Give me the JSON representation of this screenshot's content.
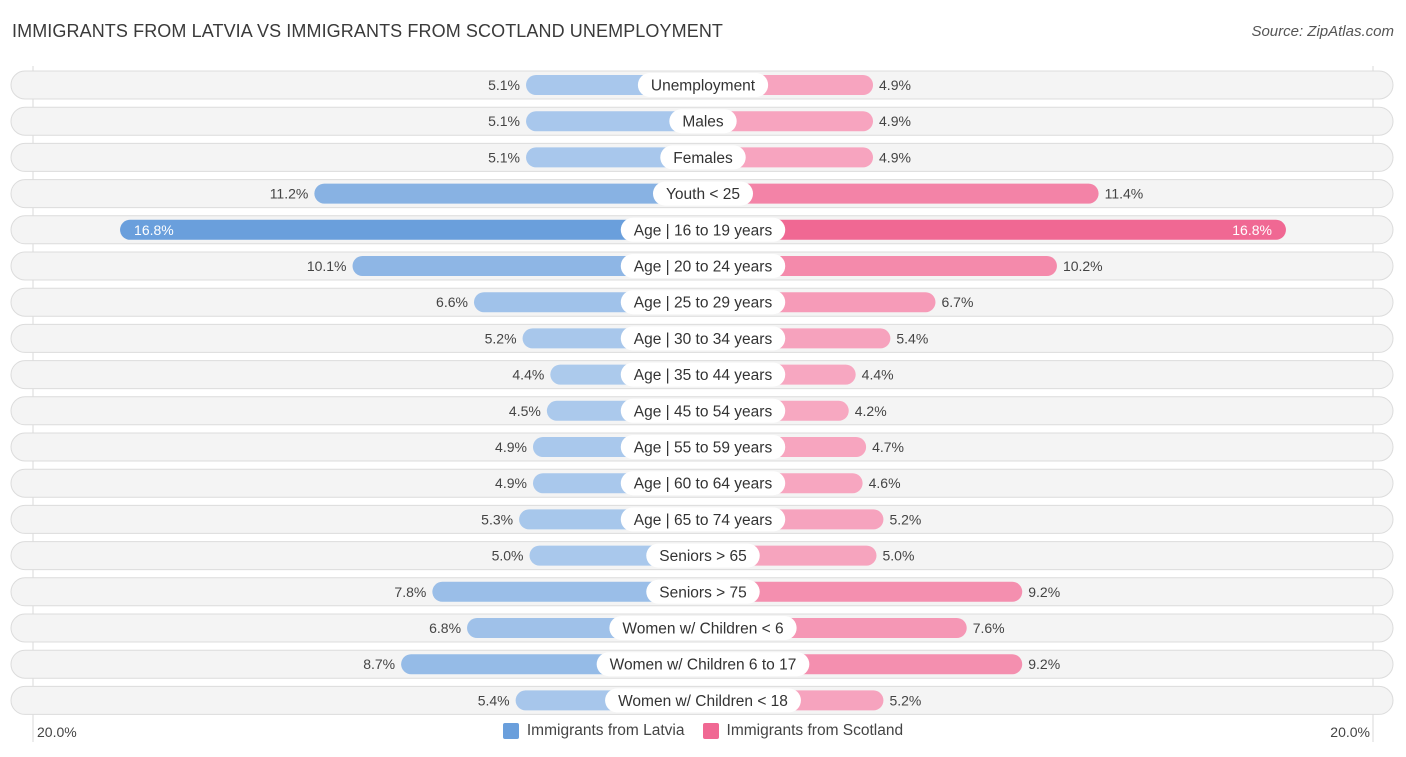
{
  "header": {
    "title": "IMMIGRANTS FROM LATVIA VS IMMIGRANTS FROM SCOTLAND UNEMPLOYMENT",
    "source": "Source: ZipAtlas.com"
  },
  "colors": {
    "latvia": "#6a9fdc",
    "latvia_light": "#aecbed",
    "scotland": "#f06893",
    "scotland_light": "#f7a9c2"
  },
  "chart_data": {
    "type": "bar",
    "orientation": "horizontal-diverging",
    "title": "IMMIGRANTS FROM LATVIA VS IMMIGRANTS FROM SCOTLAND UNEMPLOYMENT",
    "unit": "%",
    "xlim": [
      -20,
      20
    ],
    "axis_labels": {
      "left": "20.0%",
      "right": "20.0%"
    },
    "legend": {
      "placement": "bottom-center",
      "entries": [
        "Immigrants from Latvia",
        "Immigrants from Scotland"
      ]
    },
    "categories": [
      "Unemployment",
      "Males",
      "Females",
      "Youth < 25",
      "Age | 16 to 19 years",
      "Age | 20 to 24 years",
      "Age | 25 to 29 years",
      "Age | 30 to 34 years",
      "Age | 35 to 44 years",
      "Age | 45 to 54 years",
      "Age | 55 to 59 years",
      "Age | 60 to 64 years",
      "Age | 65 to 74 years",
      "Seniors > 65",
      "Seniors > 75",
      "Women w/ Children < 6",
      "Women w/ Children 6 to 17",
      "Women w/ Children < 18"
    ],
    "series": [
      {
        "name": "Immigrants from Latvia",
        "side": "left",
        "values": [
          5.1,
          5.1,
          5.1,
          11.2,
          16.8,
          10.1,
          6.6,
          5.2,
          4.4,
          4.5,
          4.9,
          4.9,
          5.3,
          5.0,
          7.8,
          6.8,
          8.7,
          5.4
        ],
        "labels": [
          "5.1%",
          "5.1%",
          "5.1%",
          "11.2%",
          "16.8%",
          "10.1%",
          "6.6%",
          "5.2%",
          "4.4%",
          "4.5%",
          "4.9%",
          "4.9%",
          "5.3%",
          "5.0%",
          "7.8%",
          "6.8%",
          "8.7%",
          "5.4%"
        ]
      },
      {
        "name": "Immigrants from Scotland",
        "side": "right",
        "values": [
          4.9,
          4.9,
          4.9,
          11.4,
          16.8,
          10.2,
          6.7,
          5.4,
          4.4,
          4.2,
          4.7,
          4.6,
          5.2,
          5.0,
          9.2,
          7.6,
          9.2,
          5.2
        ],
        "labels": [
          "4.9%",
          "4.9%",
          "4.9%",
          "11.4%",
          "16.8%",
          "10.2%",
          "6.7%",
          "5.4%",
          "4.4%",
          "4.2%",
          "4.7%",
          "4.6%",
          "5.2%",
          "5.0%",
          "9.2%",
          "7.6%",
          "9.2%",
          "5.2%"
        ]
      }
    ],
    "highlight_index": 4
  }
}
